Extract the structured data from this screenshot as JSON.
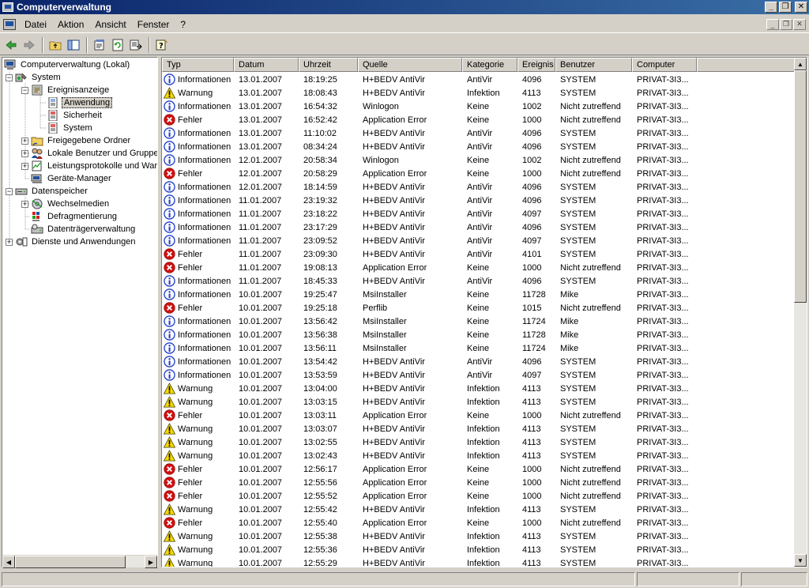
{
  "window": {
    "title": "Computerverwaltung"
  },
  "menu": [
    "Datei",
    "Aktion",
    "Ansicht",
    "Fenster",
    "?"
  ],
  "tree": {
    "root": "Computerverwaltung (Lokal)",
    "system": "System",
    "event_viewer": "Ereignisanzeige",
    "application": "Anwendung",
    "security": "Sicherheit",
    "system_log": "System",
    "shared_folders": "Freigegebene Ordner",
    "local_users": "Lokale Benutzer und Gruppen",
    "perf_logs": "Leistungsprotokolle und Warnungen",
    "device_manager": "Geräte-Manager",
    "storage": "Datenspeicher",
    "removable": "Wechselmedien",
    "defrag": "Defragmentierung",
    "disk_mgmt": "Datenträgerverwaltung",
    "services": "Dienste und Anwendungen"
  },
  "columns": [
    "Typ",
    "Datum",
    "Uhrzeit",
    "Quelle",
    "Kategorie",
    "Ereignis",
    "Benutzer",
    "Computer"
  ],
  "events": [
    [
      "Informationen",
      "13.01.2007",
      "18:19:25",
      "H+BEDV AntiVir",
      "AntiVir",
      "4096",
      "SYSTEM",
      "PRIVAT-3I3..."
    ],
    [
      "Warnung",
      "13.01.2007",
      "18:08:43",
      "H+BEDV AntiVir",
      "Infektion",
      "4113",
      "SYSTEM",
      "PRIVAT-3I3..."
    ],
    [
      "Informationen",
      "13.01.2007",
      "16:54:32",
      "Winlogon",
      "Keine",
      "1002",
      "Nicht zutreffend",
      "PRIVAT-3I3..."
    ],
    [
      "Fehler",
      "13.01.2007",
      "16:52:42",
      "Application Error",
      "Keine",
      "1000",
      "Nicht zutreffend",
      "PRIVAT-3I3..."
    ],
    [
      "Informationen",
      "13.01.2007",
      "11:10:02",
      "H+BEDV AntiVir",
      "AntiVir",
      "4096",
      "SYSTEM",
      "PRIVAT-3I3..."
    ],
    [
      "Informationen",
      "13.01.2007",
      "08:34:24",
      "H+BEDV AntiVir",
      "AntiVir",
      "4096",
      "SYSTEM",
      "PRIVAT-3I3..."
    ],
    [
      "Informationen",
      "12.01.2007",
      "20:58:34",
      "Winlogon",
      "Keine",
      "1002",
      "Nicht zutreffend",
      "PRIVAT-3I3..."
    ],
    [
      "Fehler",
      "12.01.2007",
      "20:58:29",
      "Application Error",
      "Keine",
      "1000",
      "Nicht zutreffend",
      "PRIVAT-3I3..."
    ],
    [
      "Informationen",
      "12.01.2007",
      "18:14:59",
      "H+BEDV AntiVir",
      "AntiVir",
      "4096",
      "SYSTEM",
      "PRIVAT-3I3..."
    ],
    [
      "Informationen",
      "11.01.2007",
      "23:19:32",
      "H+BEDV AntiVir",
      "AntiVir",
      "4096",
      "SYSTEM",
      "PRIVAT-3I3..."
    ],
    [
      "Informationen",
      "11.01.2007",
      "23:18:22",
      "H+BEDV AntiVir",
      "AntiVir",
      "4097",
      "SYSTEM",
      "PRIVAT-3I3..."
    ],
    [
      "Informationen",
      "11.01.2007",
      "23:17:29",
      "H+BEDV AntiVir",
      "AntiVir",
      "4096",
      "SYSTEM",
      "PRIVAT-3I3..."
    ],
    [
      "Informationen",
      "11.01.2007",
      "23:09:52",
      "H+BEDV AntiVir",
      "AntiVir",
      "4097",
      "SYSTEM",
      "PRIVAT-3I3..."
    ],
    [
      "Fehler",
      "11.01.2007",
      "23:09:30",
      "H+BEDV AntiVir",
      "AntiVir",
      "4101",
      "SYSTEM",
      "PRIVAT-3I3..."
    ],
    [
      "Fehler",
      "11.01.2007",
      "19:08:13",
      "Application Error",
      "Keine",
      "1000",
      "Nicht zutreffend",
      "PRIVAT-3I3..."
    ],
    [
      "Informationen",
      "11.01.2007",
      "18:45:33",
      "H+BEDV AntiVir",
      "AntiVir",
      "4096",
      "SYSTEM",
      "PRIVAT-3I3..."
    ],
    [
      "Informationen",
      "10.01.2007",
      "19:25:47",
      "MsiInstaller",
      "Keine",
      "11728",
      "Mike",
      "PRIVAT-3I3..."
    ],
    [
      "Fehler",
      "10.01.2007",
      "19:25:18",
      "Perflib",
      "Keine",
      "1015",
      "Nicht zutreffend",
      "PRIVAT-3I3..."
    ],
    [
      "Informationen",
      "10.01.2007",
      "13:56:42",
      "MsiInstaller",
      "Keine",
      "11724",
      "Mike",
      "PRIVAT-3I3..."
    ],
    [
      "Informationen",
      "10.01.2007",
      "13:56:38",
      "MsiInstaller",
      "Keine",
      "11728",
      "Mike",
      "PRIVAT-3I3..."
    ],
    [
      "Informationen",
      "10.01.2007",
      "13:56:11",
      "MsiInstaller",
      "Keine",
      "11724",
      "Mike",
      "PRIVAT-3I3..."
    ],
    [
      "Informationen",
      "10.01.2007",
      "13:54:42",
      "H+BEDV AntiVir",
      "AntiVir",
      "4096",
      "SYSTEM",
      "PRIVAT-3I3..."
    ],
    [
      "Informationen",
      "10.01.2007",
      "13:53:59",
      "H+BEDV AntiVir",
      "AntiVir",
      "4097",
      "SYSTEM",
      "PRIVAT-3I3..."
    ],
    [
      "Warnung",
      "10.01.2007",
      "13:04:00",
      "H+BEDV AntiVir",
      "Infektion",
      "4113",
      "SYSTEM",
      "PRIVAT-3I3..."
    ],
    [
      "Warnung",
      "10.01.2007",
      "13:03:15",
      "H+BEDV AntiVir",
      "Infektion",
      "4113",
      "SYSTEM",
      "PRIVAT-3I3..."
    ],
    [
      "Fehler",
      "10.01.2007",
      "13:03:11",
      "Application Error",
      "Keine",
      "1000",
      "Nicht zutreffend",
      "PRIVAT-3I3..."
    ],
    [
      "Warnung",
      "10.01.2007",
      "13:03:07",
      "H+BEDV AntiVir",
      "Infektion",
      "4113",
      "SYSTEM",
      "PRIVAT-3I3..."
    ],
    [
      "Warnung",
      "10.01.2007",
      "13:02:55",
      "H+BEDV AntiVir",
      "Infektion",
      "4113",
      "SYSTEM",
      "PRIVAT-3I3..."
    ],
    [
      "Warnung",
      "10.01.2007",
      "13:02:43",
      "H+BEDV AntiVir",
      "Infektion",
      "4113",
      "SYSTEM",
      "PRIVAT-3I3..."
    ],
    [
      "Fehler",
      "10.01.2007",
      "12:56:17",
      "Application Error",
      "Keine",
      "1000",
      "Nicht zutreffend",
      "PRIVAT-3I3..."
    ],
    [
      "Fehler",
      "10.01.2007",
      "12:55:56",
      "Application Error",
      "Keine",
      "1000",
      "Nicht zutreffend",
      "PRIVAT-3I3..."
    ],
    [
      "Fehler",
      "10.01.2007",
      "12:55:52",
      "Application Error",
      "Keine",
      "1000",
      "Nicht zutreffend",
      "PRIVAT-3I3..."
    ],
    [
      "Warnung",
      "10.01.2007",
      "12:55:42",
      "H+BEDV AntiVir",
      "Infektion",
      "4113",
      "SYSTEM",
      "PRIVAT-3I3..."
    ],
    [
      "Fehler",
      "10.01.2007",
      "12:55:40",
      "Application Error",
      "Keine",
      "1000",
      "Nicht zutreffend",
      "PRIVAT-3I3..."
    ],
    [
      "Warnung",
      "10.01.2007",
      "12:55:38",
      "H+BEDV AntiVir",
      "Infektion",
      "4113",
      "SYSTEM",
      "PRIVAT-3I3..."
    ],
    [
      "Warnung",
      "10.01.2007",
      "12:55:36",
      "H+BEDV AntiVir",
      "Infektion",
      "4113",
      "SYSTEM",
      "PRIVAT-3I3..."
    ],
    [
      "Warnung",
      "10.01.2007",
      "12:55:29",
      "H+BEDV AntiVir",
      "Infektion",
      "4113",
      "SYSTEM",
      "PRIVAT-3I3..."
    ]
  ],
  "colors": {
    "titlebar": "#0a246a",
    "info": "#1e3cc8",
    "warning": "#f5d800",
    "error": "#d01010"
  }
}
